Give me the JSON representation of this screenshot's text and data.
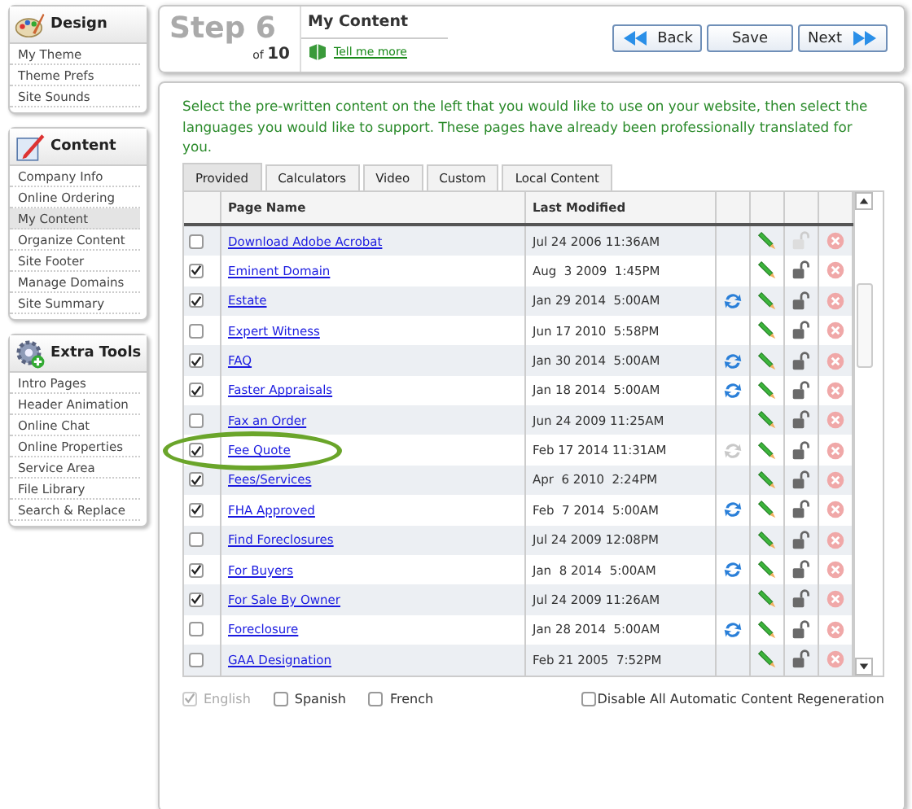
{
  "sidebar": [
    {
      "title": "Design",
      "items": [
        {
          "label": "My Theme",
          "selected": false
        },
        {
          "label": "Theme Prefs",
          "selected": false
        },
        {
          "label": "Site Sounds",
          "selected": false
        }
      ]
    },
    {
      "title": "Content",
      "items": [
        {
          "label": "Company Info",
          "selected": false
        },
        {
          "label": "Online Ordering",
          "selected": false
        },
        {
          "label": "My Content",
          "selected": true
        },
        {
          "label": "Organize Content",
          "selected": false
        },
        {
          "label": "Site Footer",
          "selected": false
        },
        {
          "label": "Manage Domains",
          "selected": false
        },
        {
          "label": "Site Summary",
          "selected": false
        }
      ]
    },
    {
      "title": "Extra Tools",
      "items": [
        {
          "label": "Intro Pages",
          "selected": false
        },
        {
          "label": "Header Animation",
          "selected": false
        },
        {
          "label": "Online Chat",
          "selected": false
        },
        {
          "label": "Online Properties",
          "selected": false
        },
        {
          "label": "Service Area",
          "selected": false
        },
        {
          "label": "File Library",
          "selected": false
        },
        {
          "label": "Search & Replace",
          "selected": false
        }
      ]
    }
  ],
  "header": {
    "step": "Step 6",
    "of": "of",
    "total": "10",
    "title": "My Content",
    "help_link": "Tell me more",
    "buttons": [
      {
        "label": "Back",
        "kind": "back"
      },
      {
        "label": "Save",
        "kind": "plain"
      },
      {
        "label": "Next",
        "kind": "next"
      }
    ]
  },
  "instructions": "Select the pre-written content on the left that you would like to use on your website, then select the languages you would like to support.  These pages have already been professionally translated for you.",
  "tabs": [
    {
      "label": "Provided",
      "selected": true
    },
    {
      "label": "Calculators",
      "selected": false
    },
    {
      "label": "Video",
      "selected": false
    },
    {
      "label": "Custom",
      "selected": false
    },
    {
      "label": "Local Content",
      "selected": false
    }
  ],
  "table": {
    "columns": [
      "Page Name",
      "Last Modified"
    ],
    "rows": [
      {
        "checked": false,
        "name": "Download Adobe Acrobat",
        "modified": "Jul 24 2006 11:36AM",
        "lock_disabled": true
      },
      {
        "checked": true,
        "name": "Eminent Domain",
        "modified": "Aug  3 2009  1:45PM",
        "lock_disabled": false
      },
      {
        "checked": true,
        "name": "Estate",
        "modified": "Jan 29 2014  5:00AM",
        "sync": {
          "disabled": false
        },
        "lock_disabled": false
      },
      {
        "checked": false,
        "name": "Expert Witness",
        "modified": "Jun 17 2010  5:58PM",
        "lock_disabled": false
      },
      {
        "checked": true,
        "name": "FAQ",
        "modified": "Jan 30 2014  5:00AM",
        "sync": {
          "disabled": false
        },
        "lock_disabled": false
      },
      {
        "checked": true,
        "name": "Faster Appraisals",
        "modified": "Jan 18 2014  5:00AM",
        "sync": {
          "disabled": false
        },
        "lock_disabled": false
      },
      {
        "checked": false,
        "name": "Fax an Order",
        "modified": "Jun 24 2009 11:25AM",
        "lock_disabled": false
      },
      {
        "checked": true,
        "name": "Fee Quote",
        "modified": "Feb 17 2014 11:31AM",
        "sync": {
          "disabled": true
        },
        "lock_disabled": false
      },
      {
        "checked": true,
        "name": "Fees/Services",
        "modified": "Apr  6 2010  2:24PM",
        "lock_disabled": false
      },
      {
        "checked": true,
        "name": "FHA Approved",
        "modified": "Feb  7 2014  5:00AM",
        "sync": {
          "disabled": false
        },
        "lock_disabled": false
      },
      {
        "checked": false,
        "name": "Find Foreclosures",
        "modified": "Jul 24 2009 12:08PM",
        "lock_disabled": false
      },
      {
        "checked": true,
        "name": "For Buyers",
        "modified": "Jan  8 2014  5:00AM",
        "sync": {
          "disabled": false
        },
        "lock_disabled": false
      },
      {
        "checked": true,
        "name": "For Sale By Owner",
        "modified": "Jul 24 2009 11:26AM",
        "lock_disabled": false
      },
      {
        "checked": false,
        "name": "Foreclosure",
        "modified": "Jan 28 2014  5:00AM",
        "sync": {
          "disabled": false
        },
        "lock_disabled": false
      },
      {
        "checked": false,
        "name": "GAA Designation",
        "modified": "Feb 21 2005  7:52PM",
        "lock_disabled": false
      }
    ]
  },
  "languages": [
    {
      "label": "English",
      "checked": true,
      "disabled": true
    },
    {
      "label": "Spanish",
      "checked": false,
      "disabled": false
    },
    {
      "label": "French",
      "checked": false,
      "disabled": false
    }
  ],
  "disable_regeneration": {
    "label": "Disable All Automatic Content Regeneration",
    "checked": false
  }
}
